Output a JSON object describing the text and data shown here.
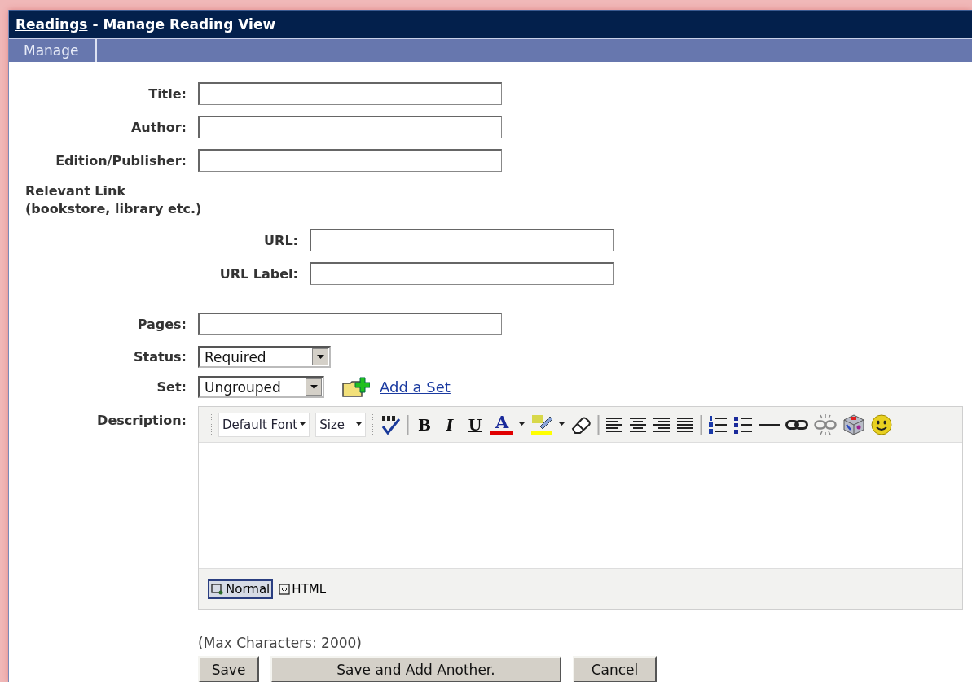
{
  "header": {
    "link": "Readings",
    "title": " - Manage Reading View"
  },
  "tabs": [
    {
      "label": "Manage",
      "selected": true
    }
  ],
  "fields": [
    {
      "kind": "text",
      "label": "Title:"
    },
    {
      "kind": "text",
      "label": "Author:"
    },
    {
      "kind": "text",
      "label": "Edition/Publisher:"
    },
    {
      "kind": "heading",
      "lines": [
        "Relevant Link",
        "(bookstore, library etc.)"
      ]
    },
    {
      "kind": "subtext",
      "label": "URL:"
    },
    {
      "kind": "subtext",
      "label": "URL Label:"
    },
    {
      "kind": "text",
      "label": "Pages:"
    },
    {
      "kind": "select",
      "label": "Status:",
      "value": "Required"
    },
    {
      "kind": "select",
      "label": "Set:",
      "value": "Ungrouped",
      "link": "Add a Set"
    },
    {
      "kind": "editor",
      "label": "Description:"
    }
  ],
  "editor": {
    "font": "Default Font",
    "size": "Size",
    "format_buttons": [
      "B",
      "I",
      "U"
    ],
    "color_button": "A",
    "modes": [
      {
        "label": "Normal",
        "selected": true
      },
      {
        "label": "HTML",
        "selected": false
      }
    ]
  },
  "note": "(Max Characters: 2000)",
  "buttons": [
    "Save",
    "Save and Add Another.",
    "Cancel"
  ]
}
